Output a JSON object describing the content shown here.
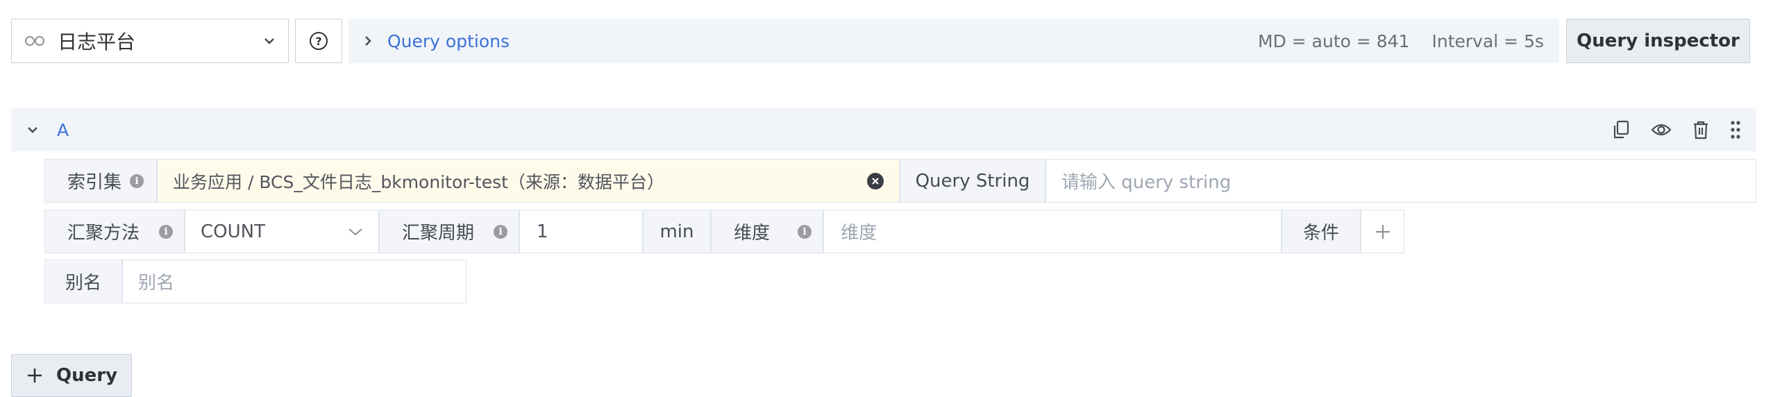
{
  "toolbar": {
    "datasource": "日志平台",
    "help_symbol": "?",
    "query_options_label": "Query options",
    "md_text": "MD = auto = 841",
    "interval_text": "Interval = 5s",
    "inspector_label": "Query inspector"
  },
  "query": {
    "ref_id": "A",
    "index_set_label": "索引集",
    "index_set_value": "业务应用 / BCS_文件日志_bkmonitor-test（来源：数据平台）",
    "query_string_label": "Query String",
    "query_string_placeholder": "请输入 query string",
    "agg_method_label": "汇聚方法",
    "agg_method_value": "COUNT",
    "agg_period_label": "汇聚周期",
    "agg_period_value": "1",
    "agg_period_unit": "min",
    "dimension_label": "维度",
    "dimension_placeholder": "维度",
    "condition_label": "条件",
    "alias_label": "别名",
    "alias_placeholder": "别名"
  },
  "add_query_label": "Query",
  "colors": {
    "accent_blue": "#3d71d7",
    "index_set_bg": "#fffbeb",
    "header_bg": "#f1f5f9"
  }
}
